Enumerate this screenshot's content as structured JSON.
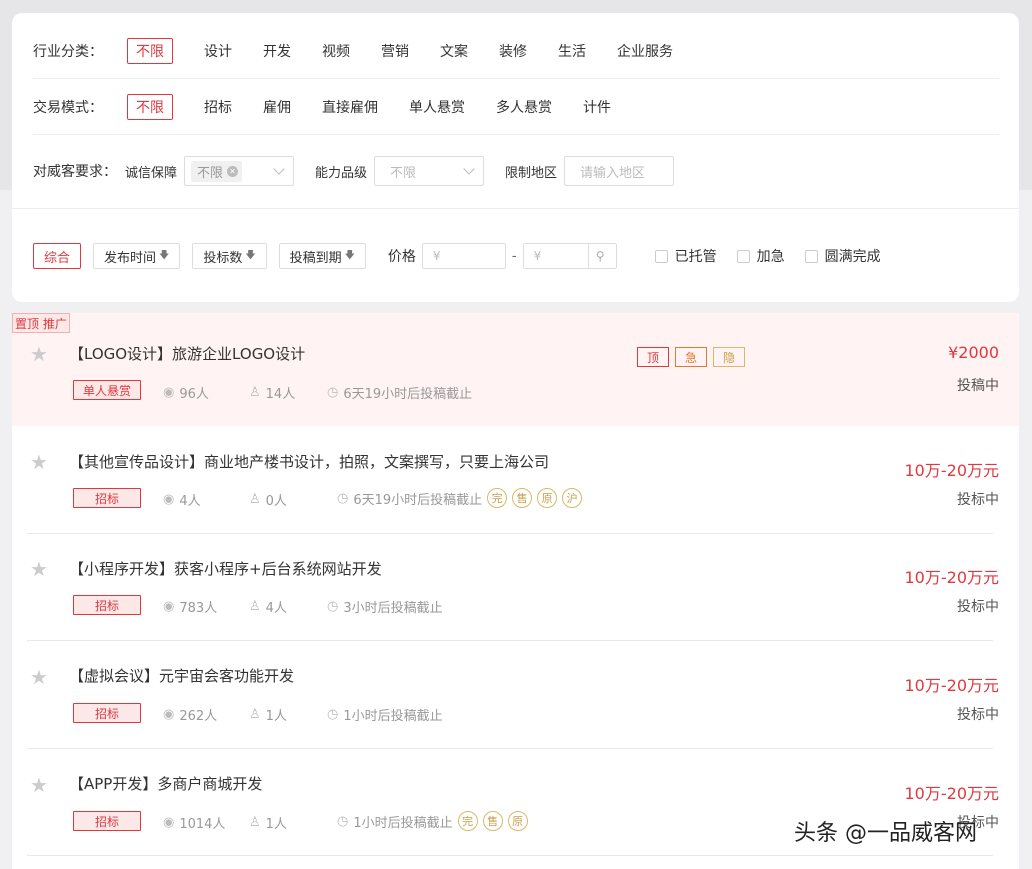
{
  "filters": {
    "industry_label": "行业分类：",
    "industry_options": [
      "不限",
      "设计",
      "开发",
      "视频",
      "营销",
      "文案",
      "装修",
      "生活",
      "企业服务"
    ],
    "trade_label": "交易模式：",
    "trade_options": [
      "不限",
      "招标",
      "雇佣",
      "直接雇佣",
      "单人悬赏",
      "多人悬赏",
      "计件"
    ],
    "req_label": "对威客要求：",
    "guarantee_label": "诚信保障",
    "guarantee_value": "不限",
    "ability_label": "能力品级",
    "ability_value": "不限",
    "region_label": "限制地区",
    "region_placeholder": "请输入地区"
  },
  "sort": {
    "buttons": [
      "综合",
      "发布时间",
      "投标数",
      "投稿到期"
    ],
    "price_label": "价格",
    "price_min_placeholder": "¥",
    "price_dash": "-",
    "price_max_placeholder": "¥",
    "checks": [
      "已托管",
      "加急",
      "圆满完成"
    ]
  },
  "top_tag": "置顶 推广",
  "tasks": [
    {
      "title": "【LOGO设计】旅游企业LOGO设计",
      "badge": "单人悬赏",
      "views": "96人",
      "bids": "14人",
      "deadline": "6天19小时后投稿截止",
      "price": "¥2000",
      "status": "投稿中",
      "tags": [
        "顶",
        "急",
        "隐"
      ],
      "circles": []
    },
    {
      "title": "【其他宣传品设计】商业地产楼书设计，拍照，文案撰写，只要上海公司",
      "badge": "招标",
      "views": "4人",
      "bids": "0人",
      "deadline": "6天19小时后投稿截止",
      "price": "10万-20万元",
      "status": "投标中",
      "tags": [],
      "circles": [
        "完",
        "售",
        "原",
        "沪"
      ]
    },
    {
      "title": "【小程序开发】获客小程序+后台系统网站开发",
      "badge": "招标",
      "views": "783人",
      "bids": "4人",
      "deadline": "3小时后投稿截止",
      "price": "10万-20万元",
      "status": "投标中",
      "tags": [],
      "circles": []
    },
    {
      "title": "【虚拟会议】元宇宙会客功能开发",
      "badge": "招标",
      "views": "262人",
      "bids": "1人",
      "deadline": "1小时后投稿截止",
      "price": "10万-20万元",
      "status": "投标中",
      "tags": [],
      "circles": []
    },
    {
      "title": "【APP开发】多商户商城开发",
      "badge": "招标",
      "views": "1014人",
      "bids": "1人",
      "deadline": "1小时后投稿截止",
      "price": "10万-20万元",
      "status": "投标中",
      "tags": [],
      "circles": [
        "完",
        "售",
        "原"
      ]
    }
  ],
  "watermark": "头条 @一品威客网",
  "colors": {
    "accent": "#e0383e",
    "gold": "#c9a04a",
    "orange": "#e07a30"
  }
}
